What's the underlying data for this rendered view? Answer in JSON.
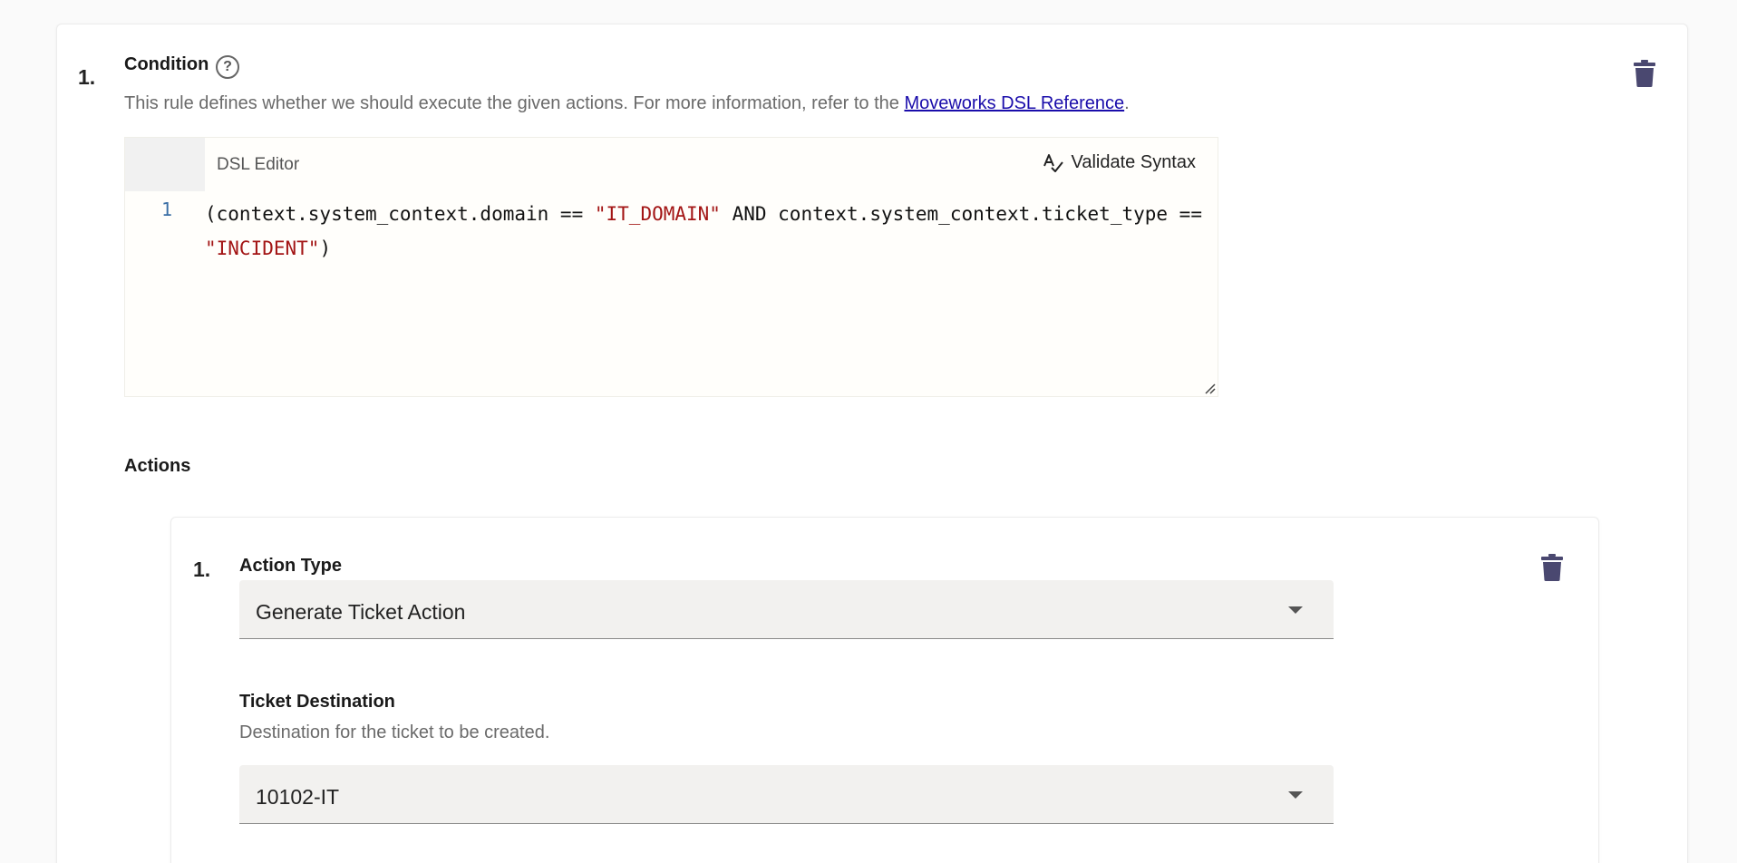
{
  "rule": {
    "number": "1.",
    "title": "Condition",
    "description_prefix": "This rule defines whether we should execute the given actions. For more information, refer to the ",
    "link_text": "Moveworks DSL Reference",
    "description_suffix": ".",
    "editor": {
      "label": "DSL Editor",
      "validate_label": "Validate Syntax",
      "line_number": "1",
      "code_part1": "(context.system_context.domain == ",
      "code_str1": "\"IT_DOMAIN\"",
      "code_part2": " AND context.system_context.ticket_type == ",
      "code_str2": "\"INCIDENT\"",
      "code_part3": ")"
    }
  },
  "actions": {
    "title": "Actions",
    "items": [
      {
        "number": "1.",
        "action_type_label": "Action Type",
        "action_type_value": "Generate Ticket Action",
        "destination_label": "Ticket Destination",
        "destination_help": "Destination for the ticket to be created.",
        "destination_value": "10102-IT"
      }
    ]
  },
  "colors": {
    "trash_icon": "#4a4870",
    "link": "#1a0dab",
    "string_literal": "#a31515",
    "line_number": "#3a6ea5"
  }
}
